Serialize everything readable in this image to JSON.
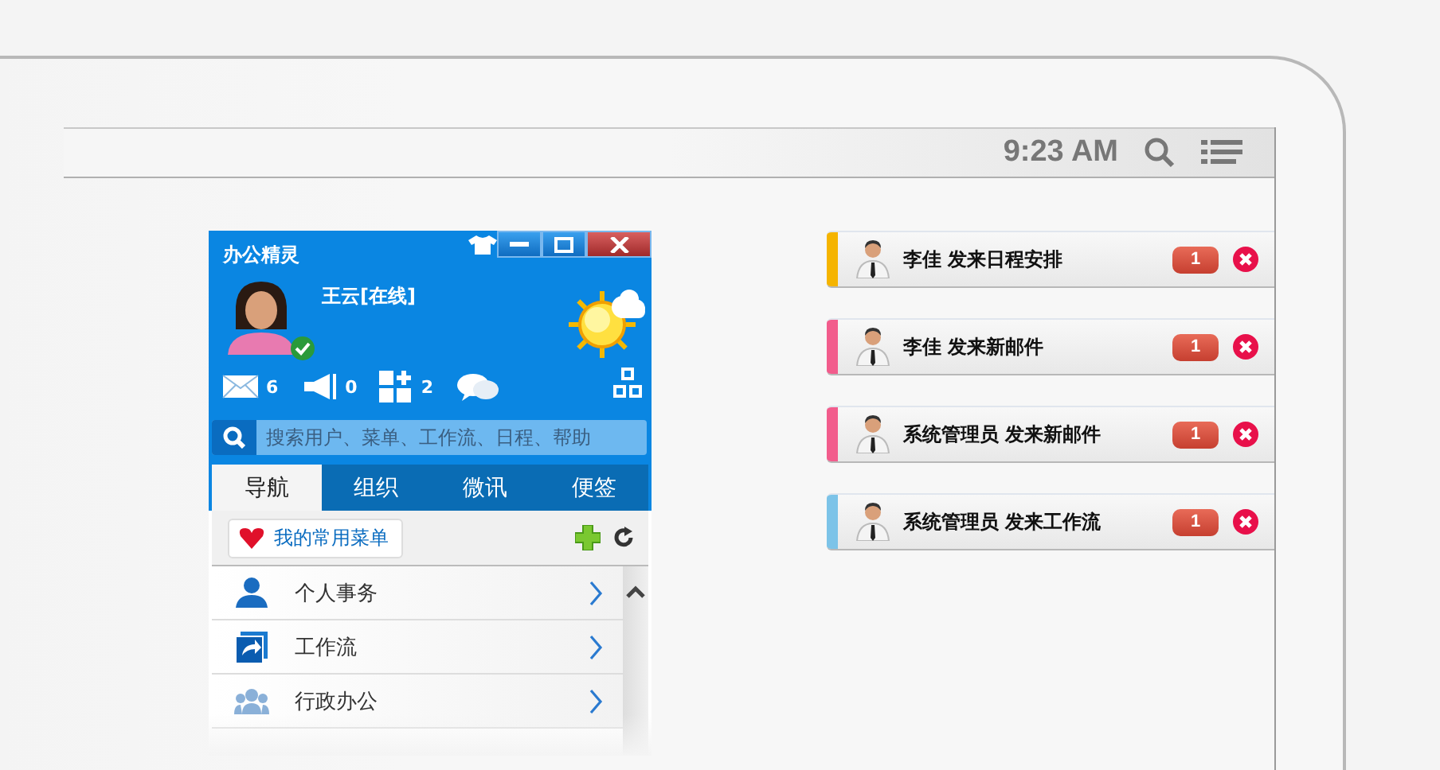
{
  "status_bar": {
    "time": "9:23 AM"
  },
  "app": {
    "title": "办公精灵",
    "user": "王云[在线]",
    "online": true,
    "counters": [
      {
        "kind": "mail",
        "count": "6"
      },
      {
        "kind": "notice",
        "count": "0"
      },
      {
        "kind": "apps",
        "count": "2"
      },
      {
        "kind": "chat"
      }
    ],
    "search": {
      "placeholder": "搜索用户、菜单、工作流、日程、帮助"
    },
    "tabs": [
      {
        "label": "导航",
        "selected": true
      },
      {
        "label": "组织",
        "selected": false
      },
      {
        "label": "微讯",
        "selected": false
      },
      {
        "label": "便签",
        "selected": false
      }
    ],
    "favorites": "我的常用菜单",
    "menu": [
      {
        "label": "个人事务",
        "kind": "person"
      },
      {
        "label": "工作流",
        "kind": "flow"
      },
      {
        "label": "行政办公",
        "kind": "group"
      }
    ]
  },
  "notifications": [
    {
      "sender": "李佳",
      "message": "发来日程安排",
      "count": "1",
      "color": "#f5b400"
    },
    {
      "sender": "李佳",
      "message": "发来新邮件",
      "count": "1",
      "color": "#f25c8c"
    },
    {
      "sender": "系统管理员",
      "message": "发来新邮件",
      "count": "1",
      "color": "#f25c8c"
    },
    {
      "sender": "系统管理员",
      "message": "发来工作流",
      "count": "1",
      "color": "#7cc3e8"
    }
  ]
}
